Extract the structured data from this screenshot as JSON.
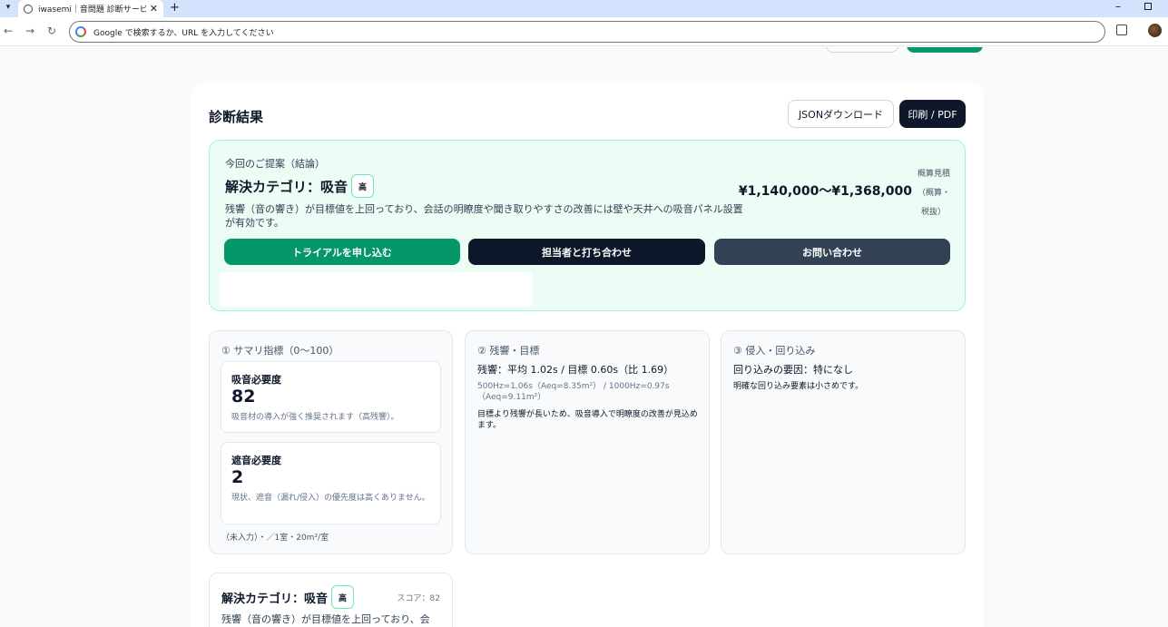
{
  "browser": {
    "tab_title": "iwasemi｜音問題 診断サービス",
    "url_placeholder": "Google で検索するか、URL を入力してください"
  },
  "result": {
    "title": "診断結果",
    "json_button": "JSONダウンロード",
    "print_button": "印刷 / PDF"
  },
  "proposal": {
    "kicker": "今回のご提案（結論）",
    "title": "解決カテゴリ：吸音",
    "badge": "高",
    "description": "残響（音の響き）が目標値を上回っており、会話の明瞭度や聞き取りやすさの改善には壁や天井への吸音パネル設置が有効です。",
    "estimate_label": "概算見積",
    "estimate_value": "¥1,140,000〜¥1,368,000",
    "estimate_note_1": "（概算・",
    "estimate_note_2": "税抜）",
    "cta_trial": "トライアルを申し込む",
    "cta_meeting": "担当者と打ち合わせ",
    "cta_contact": "お問い合わせ"
  },
  "summary": {
    "heading": "① サマリ指標（0〜100）",
    "absorption_title": "吸音必要度",
    "absorption_value": "82",
    "absorption_note": "吸音材の導入が強く推奨されます（高残響）。",
    "insulation_title": "遮音必要度",
    "insulation_value": "2",
    "insulation_note": "現状、遮音（漏れ/侵入）の優先度は高くありません。",
    "footer": "（未入力）・／1室・20m²/室"
  },
  "reverb": {
    "heading": "② 残響・目標",
    "main": "残響：平均 1.02s / 目標 0.60s（比 1.69）",
    "detail": "500Hz=1.06s（Aeq=8.35m²） / 1000Hz=0.97s（Aeq=9.11m²）",
    "text": "目標より残響が長いため、吸音導入で明瞭度の改善が見込めます。"
  },
  "intrusion": {
    "heading": "③ 侵入・回り込み",
    "main": "回り込みの要因：特になし",
    "text": "明確な回り込み要素は小さめです。"
  },
  "category_card": {
    "title": "解決カテゴリ：吸音",
    "badge": "高",
    "score": "スコア：82",
    "description": "残響（音の響き）が目標値を上回っており、会"
  }
}
